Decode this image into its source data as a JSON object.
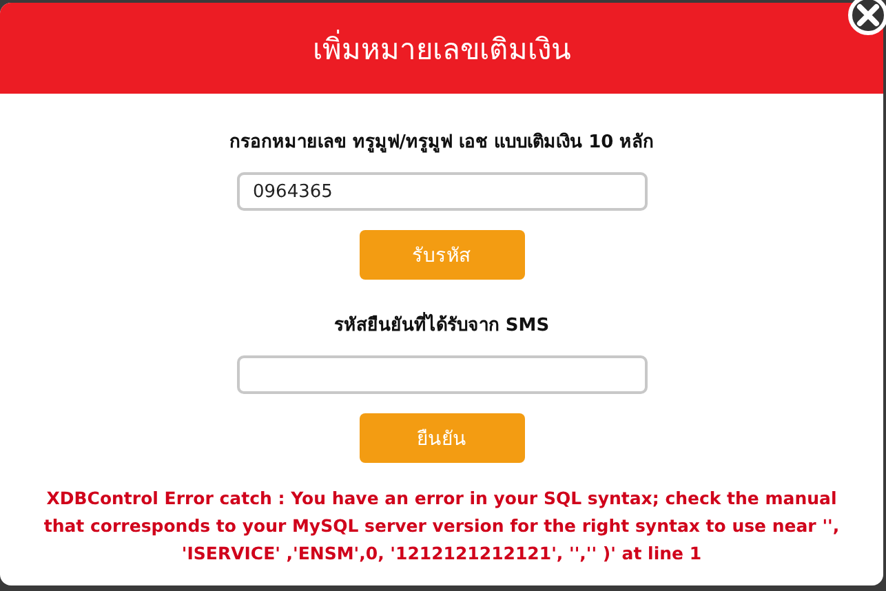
{
  "dialog": {
    "title": "เพิ่มหมายเลขเติมเงิน",
    "phone_label": "กรอกหมายเลข ทรูมูฟ/ทรูมูฟ เอช แบบเติมเงิน 10 หลัก",
    "phone_value": "0964365",
    "request_button": "รับรหัส",
    "code_label": "รหัสยืนยันที่ได้รับจาก SMS",
    "confirm_button": "ยืนยัน",
    "error": "XDBControl Error catch : You have an error in your SQL syntax; check the manual that corresponds to your MySQL server version for the right syntax to use near '', 'ISERVICE' ,'ENSM',0, '1212121212121', '','' )' at line 1"
  }
}
